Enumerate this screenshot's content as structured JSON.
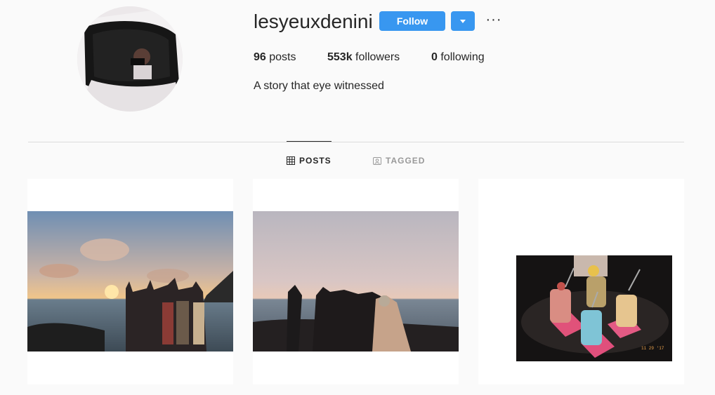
{
  "profile": {
    "username": "lesyeuxdenini",
    "follow_label": "Follow",
    "more_label": "···",
    "stats": {
      "posts_count": "96",
      "posts_label": "posts",
      "followers_count": "553k",
      "followers_label": "followers",
      "following_count": "0",
      "following_label": "following"
    },
    "bio": "A story that eye witnessed"
  },
  "tabs": [
    {
      "label": "POSTS",
      "icon": "grid-icon",
      "active": true
    },
    {
      "label": "TAGGED",
      "icon": "tag-user-icon",
      "active": false
    }
  ],
  "posts": [
    {
      "name": "post-sunset-group-raised-arms"
    },
    {
      "name": "post-sunset-group-hugging"
    },
    {
      "name": "post-colorful-drinks",
      "stamp": "11 29 '17"
    }
  ],
  "colors": {
    "accent": "#3897f0",
    "text": "#262626",
    "muted": "#999999",
    "divider": "#dbdbdb",
    "background": "#fafafa"
  }
}
